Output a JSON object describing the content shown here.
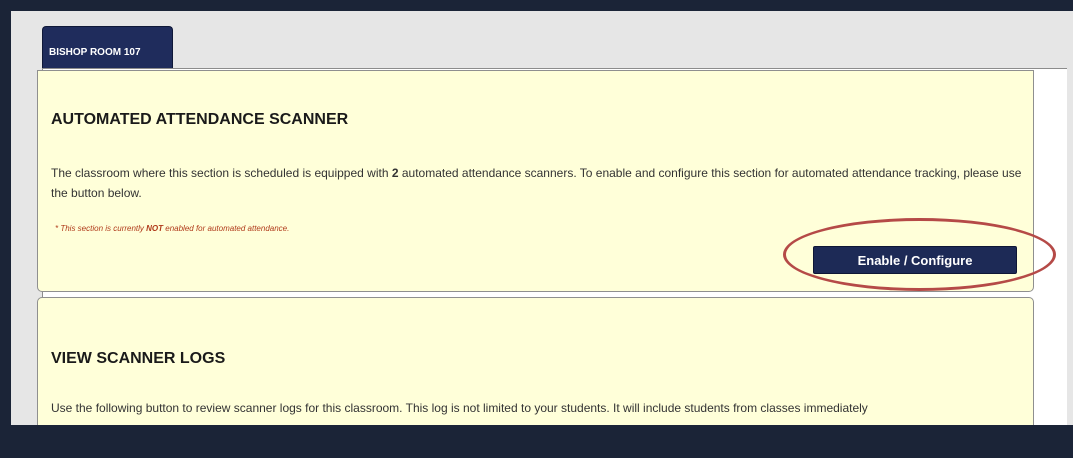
{
  "tab": {
    "label": "BISHOP ROOM 107"
  },
  "scanner_card": {
    "title": "AUTOMATED ATTENDANCE SCANNER",
    "text_before_count": "The classroom where this section is scheduled is equipped with ",
    "scanner_count": "2",
    "text_after_count": " automated attendance scanners. To enable and configure this section for automated attendance tracking, please use the button below.",
    "note_prefix": "* This section is currently ",
    "note_emphasis": "NOT",
    "note_suffix": " enabled for automated attendance.",
    "button_label": "Enable / Configure"
  },
  "logs_card": {
    "title": "VIEW SCANNER LOGS",
    "text": "Use the following button to review scanner logs for this classroom. This log is not limited to your students. It will include students from classes immediately"
  },
  "colors": {
    "background": "#1b2437",
    "tab": "#1f2c5c",
    "card": "#ffffd9",
    "button": "#1d2a56",
    "highlight_ring": "#b54a47",
    "note": "#b03a1a"
  }
}
